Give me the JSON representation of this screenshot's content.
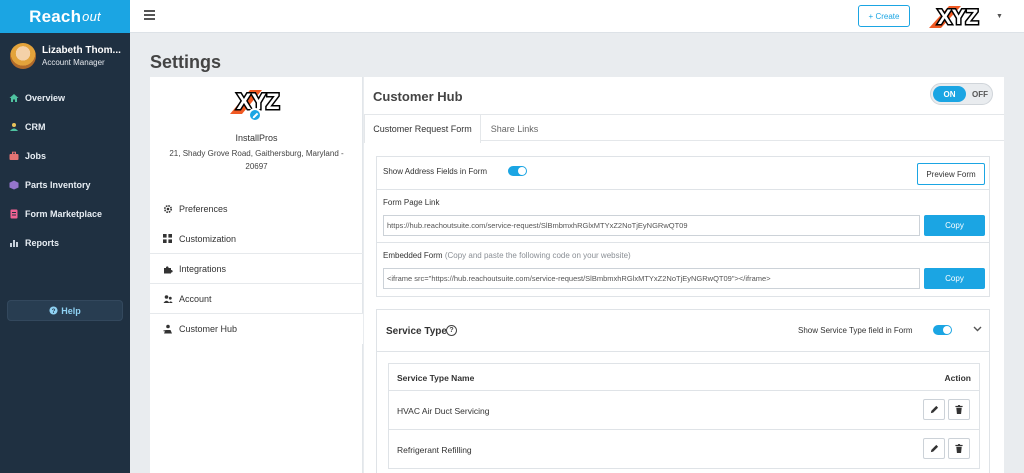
{
  "app": {
    "brand": "Reach",
    "brand_suffix": "out"
  },
  "user": {
    "name": "Lizabeth Thom...",
    "role": "Account Manager"
  },
  "sidebar": {
    "items": [
      {
        "label": "Overview",
        "icon": "home-icon"
      },
      {
        "label": "CRM",
        "icon": "crm-icon"
      },
      {
        "label": "Jobs",
        "icon": "briefcase-icon"
      },
      {
        "label": "Parts Inventory",
        "icon": "box-icon"
      },
      {
        "label": "Form Marketplace",
        "icon": "form-icon"
      },
      {
        "label": "Reports",
        "icon": "bar-chart-icon"
      }
    ],
    "help": "Help"
  },
  "topbar": {
    "create": "+ Create",
    "logo_text": "XYZ"
  },
  "page": {
    "title": "Settings"
  },
  "company": {
    "logo_text": "XYZ",
    "name": "InstallPros",
    "address": "21, Shady Grove Road, Gaithersburg, Maryland - 20697"
  },
  "settings_nav": [
    {
      "label": "Preferences",
      "icon": "gear-icon"
    },
    {
      "label": "Customization",
      "icon": "grid-icon"
    },
    {
      "label": "Integrations",
      "icon": "puzzle-icon"
    },
    {
      "label": "Account",
      "icon": "users-icon"
    },
    {
      "label": "Customer Hub",
      "icon": "hub-icon"
    }
  ],
  "hub": {
    "title": "Customer Hub",
    "toggle_on": "ON",
    "toggle_off": "OFF",
    "tabs": [
      "Customer Request Form",
      "Share Links"
    ],
    "show_address_label": "Show Address Fields in Form",
    "preview_button": "Preview Form",
    "form_page_link_label": "Form Page Link",
    "form_page_link_value": "https://hub.reachoutsuite.com/service-request/SlBmbmxhRGlxMTYxZ2NoTjEyNGRwQT09",
    "embedded_label": "Embedded Form",
    "embedded_hint": "(Copy and paste the following code on your website)",
    "embedded_value": "<iframe src=\"https://hub.reachoutsuite.com/service-request/SlBmbmxhRGlxMTYxZ2NoTjEyNGRwQT09\"></iframe>",
    "copy_label": "Copy"
  },
  "service_type": {
    "title": "Service Type",
    "show_label": "Show Service Type field in Form",
    "columns": [
      "Service Type Name",
      "Action"
    ],
    "rows": [
      "HVAC Air Duct Servicing",
      "Refrigerant Refilling"
    ]
  },
  "colors": {
    "accent": "#1ba5e3",
    "sidebar": "#1f3041"
  }
}
